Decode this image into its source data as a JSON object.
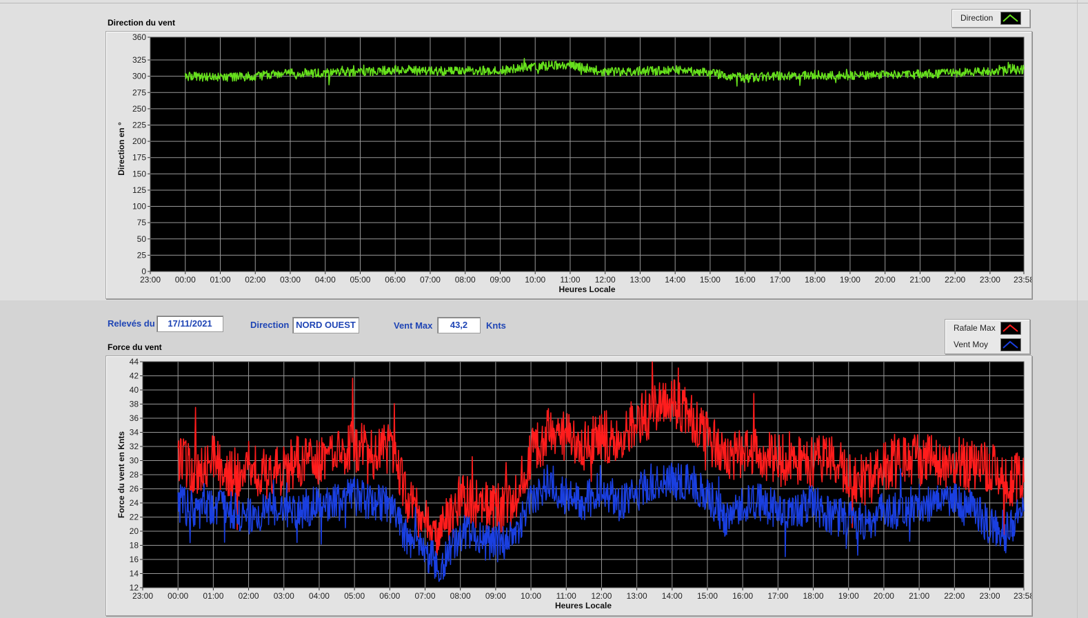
{
  "direction_panel": {
    "title": "Direction du vent",
    "y_axis_label": "Direction en °",
    "x_axis_label": "Heures Locale",
    "legend": [
      {
        "label": "Direction",
        "color": "#66e01c"
      }
    ]
  },
  "info_bar": {
    "date_label": "Relevés du",
    "date_value": "17/11/2021",
    "direction_label": "Direction",
    "direction_value": "NORD OUEST",
    "vent_max_label": "Vent Max",
    "vent_max_value": "43,2",
    "vent_max_unit": "Knts"
  },
  "force_panel": {
    "title": "Force du vent",
    "y_axis_label": "Force du vent en Knts",
    "x_axis_label": "Heures Locale",
    "legend": [
      {
        "label": "Rafale Max",
        "color": "#ff1c1c"
      },
      {
        "label": "Vent Moy",
        "color": "#1a3fe0"
      }
    ]
  },
  "chart_data": [
    {
      "type": "line",
      "title": "Direction du vent",
      "xlabel": "Heures Locale",
      "ylabel": "Direction en °",
      "x_ticks": [
        "23:00",
        "00:00",
        "01:00",
        "02:00",
        "03:00",
        "04:00",
        "05:00",
        "06:00",
        "07:00",
        "08:00",
        "09:00",
        "10:00",
        "11:00",
        "12:00",
        "13:00",
        "14:00",
        "15:00",
        "16:00",
        "17:00",
        "18:00",
        "19:00",
        "20:00",
        "21:00",
        "22:00",
        "23:00",
        "23:58"
      ],
      "xlim": [
        -1,
        23.967
      ],
      "ylim": [
        0,
        360
      ],
      "y_ticks": [
        0,
        25,
        50,
        75,
        100,
        125,
        150,
        175,
        200,
        225,
        250,
        275,
        300,
        325,
        360
      ],
      "grid": true,
      "background": "#000000",
      "series": [
        {
          "name": "Direction",
          "color": "#66e01c",
          "x": [
            0,
            1,
            2,
            3,
            4,
            5,
            6,
            7,
            8,
            9,
            10,
            11,
            12,
            13,
            14,
            15,
            16,
            17,
            18,
            19,
            20,
            21,
            22,
            23,
            23.967
          ],
          "values": [
            300,
            298,
            300,
            305,
            305,
            307,
            310,
            308,
            308,
            310,
            315,
            318,
            306,
            308,
            310,
            305,
            297,
            301,
            302,
            301,
            302,
            303,
            305,
            307,
            310
          ]
        }
      ]
    },
    {
      "type": "line",
      "title": "Force du vent",
      "xlabel": "Heures Locale",
      "ylabel": "Force du vent en Knts",
      "x_ticks": [
        "23:00",
        "00:00",
        "01:00",
        "02:00",
        "03:00",
        "04:00",
        "05:00",
        "06:00",
        "07:00",
        "08:00",
        "09:00",
        "10:00",
        "11:00",
        "12:00",
        "13:00",
        "14:00",
        "15:00",
        "16:00",
        "17:00",
        "18:00",
        "19:00",
        "20:00",
        "21:00",
        "22:00",
        "23:00",
        "23:58"
      ],
      "xlim": [
        -1,
        23.967
      ],
      "ylim": [
        12,
        44
      ],
      "y_ticks": [
        12,
        14,
        16,
        18,
        20,
        22,
        24,
        26,
        28,
        30,
        32,
        34,
        36,
        38,
        40,
        42,
        44
      ],
      "grid": true,
      "background": "#000000",
      "series": [
        {
          "name": "Rafale Max",
          "color": "#ff1c1c",
          "x": [
            0,
            0.5,
            1,
            1.5,
            2,
            2.5,
            3,
            3.5,
            4,
            4.5,
            5,
            5.5,
            6,
            6.5,
            7,
            7.5,
            8,
            8.5,
            9,
            9.5,
            10,
            10.5,
            11,
            11.5,
            12,
            12.5,
            13,
            13.5,
            14,
            14.5,
            15,
            15.5,
            16,
            16.5,
            17,
            17.5,
            18,
            18.5,
            19,
            19.5,
            20,
            20.5,
            21,
            21.5,
            22,
            22.5,
            23,
            23.5,
            23.967
          ],
          "values": [
            30,
            29,
            30,
            28,
            29,
            28,
            29,
            30,
            30,
            31,
            32,
            31,
            32,
            25,
            21,
            20,
            25,
            24,
            23,
            24,
            31,
            34,
            33,
            32,
            34,
            32,
            36,
            37,
            38,
            37,
            33,
            31,
            31,
            31,
            30,
            30,
            30,
            30,
            28,
            27,
            29,
            30,
            30,
            30,
            30,
            29,
            29,
            27,
            28
          ]
        },
        {
          "name": "Vent Moy",
          "color": "#1a3fe0",
          "x": [
            0,
            0.5,
            1,
            1.5,
            2,
            2.5,
            3,
            3.5,
            4,
            4.5,
            5,
            5.5,
            6,
            6.5,
            7,
            7.5,
            8,
            8.5,
            9,
            9.5,
            10,
            10.5,
            11,
            11.5,
            12,
            12.5,
            13,
            13.5,
            14,
            14.5,
            15,
            15.5,
            16,
            16.5,
            17,
            17.5,
            18,
            18.5,
            19,
            19.5,
            20,
            20.5,
            21,
            21.5,
            22,
            22.5,
            23,
            23.5,
            23.967
          ],
          "values": [
            24,
            23,
            23,
            23,
            22,
            23,
            23,
            23,
            24,
            24,
            25,
            24,
            24,
            19,
            17,
            15,
            20,
            19,
            18,
            19,
            24,
            27,
            25,
            24,
            26,
            24,
            26,
            27,
            27,
            27,
            25,
            22,
            24,
            24,
            23,
            23,
            24,
            22,
            22,
            21,
            23,
            23,
            24,
            24,
            24,
            23,
            21,
            20,
            23
          ]
        }
      ]
    }
  ]
}
